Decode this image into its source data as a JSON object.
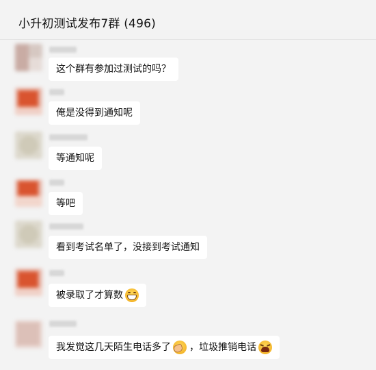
{
  "header": {
    "title": "小升初测试发布7群 (496)"
  },
  "messages": [
    {
      "text": "这个群有参加过测试的吗？"
    },
    {
      "text": "俺是没得到通知呢"
    },
    {
      "text": "等通知呢"
    },
    {
      "text": "等吧"
    },
    {
      "text": "看到考试名单了，没接到考试通知"
    },
    {
      "text": "被录取了才算数",
      "emoji": "grin-icon"
    },
    {
      "text_a": "我发觉这几天陌生电话多了",
      "emoji_a": "facepalm-icon",
      "text_b": "，垃圾推销电话",
      "emoji_b": "distress-icon"
    }
  ]
}
